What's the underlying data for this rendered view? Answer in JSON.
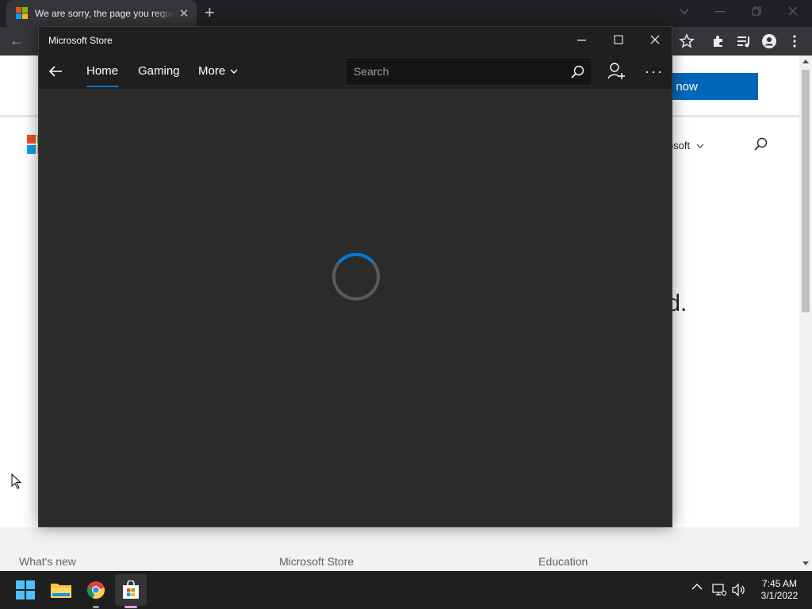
{
  "browser": {
    "tab_title": "We are sorry, the page you requested cannot be found",
    "tab_close": "✕",
    "new_tab": "+",
    "back": "←"
  },
  "background_page": {
    "banner_button": "witch now",
    "nav_all_microsoft": "ll Microsoft",
    "heading_partial": "und.",
    "footer": {
      "col1": "What's new",
      "col2": "Microsoft Store",
      "col3": "Education"
    }
  },
  "store": {
    "window_title": "Microsoft Store",
    "nav": {
      "items": [
        {
          "label": "Home",
          "active": true
        },
        {
          "label": "Gaming",
          "active": false
        },
        {
          "label": "More",
          "active": false
        }
      ]
    },
    "search": {
      "placeholder": "Search",
      "value": ""
    },
    "more_dots": "···",
    "loading": true
  },
  "taskbar": {
    "time": "7:45 AM",
    "date": "3/1/2022"
  },
  "colors": {
    "accent": "#0078d4",
    "store_bg": "#2b2b2b",
    "chrome_bg": "#202124"
  },
  "icons": [
    "windows-start-icon",
    "file-explorer-icon",
    "chrome-icon",
    "store-icon",
    "search-icon",
    "account-add-icon",
    "spinner-icon"
  ]
}
